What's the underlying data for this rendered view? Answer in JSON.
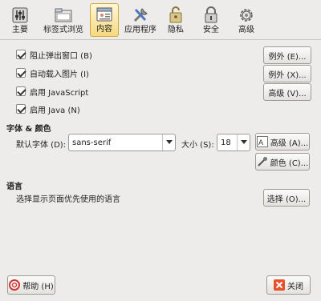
{
  "toolbar": {
    "tabs": [
      {
        "label": "主要",
        "icon": "sliders-icon"
      },
      {
        "label": "标签式浏览",
        "icon": "tabs-icon"
      },
      {
        "label": "内容",
        "icon": "content-icon",
        "active": true
      },
      {
        "label": "应用程序",
        "icon": "applications-icon"
      },
      {
        "label": "隐私",
        "icon": "privacy-icon"
      },
      {
        "label": "安全",
        "icon": "lock-icon"
      },
      {
        "label": "高级",
        "icon": "gear-icon"
      }
    ]
  },
  "content": {
    "options": [
      {
        "label": "阻止弹出窗口 (B)",
        "checked": true,
        "button": "例外 (E)..."
      },
      {
        "label": "自动载入图片 (I)",
        "checked": true,
        "button": "例外 (X)..."
      },
      {
        "label": "启用 JavaScript",
        "checked": true,
        "button": "高级 (V)..."
      },
      {
        "label": "启用 Java (N)",
        "checked": true
      }
    ],
    "fonts": {
      "heading": "字体 & 颜色",
      "default_font_label": "默认字体 (D):",
      "default_font_value": "sans-serif",
      "size_label": "大小 (S):",
      "size_value": "18",
      "advanced_button": "高级 (A)...",
      "colors_button": "颜色 (C)..."
    },
    "language": {
      "heading": "语言",
      "description": "选择显示页面优先使用的语言",
      "choose_button": "选择 (O)..."
    }
  },
  "footer": {
    "help_button": "帮助 (H)",
    "close_button": "关闭"
  },
  "colors": {
    "accent": "#f5d880",
    "close_icon": "#e8502a",
    "background": "#edeceb"
  }
}
